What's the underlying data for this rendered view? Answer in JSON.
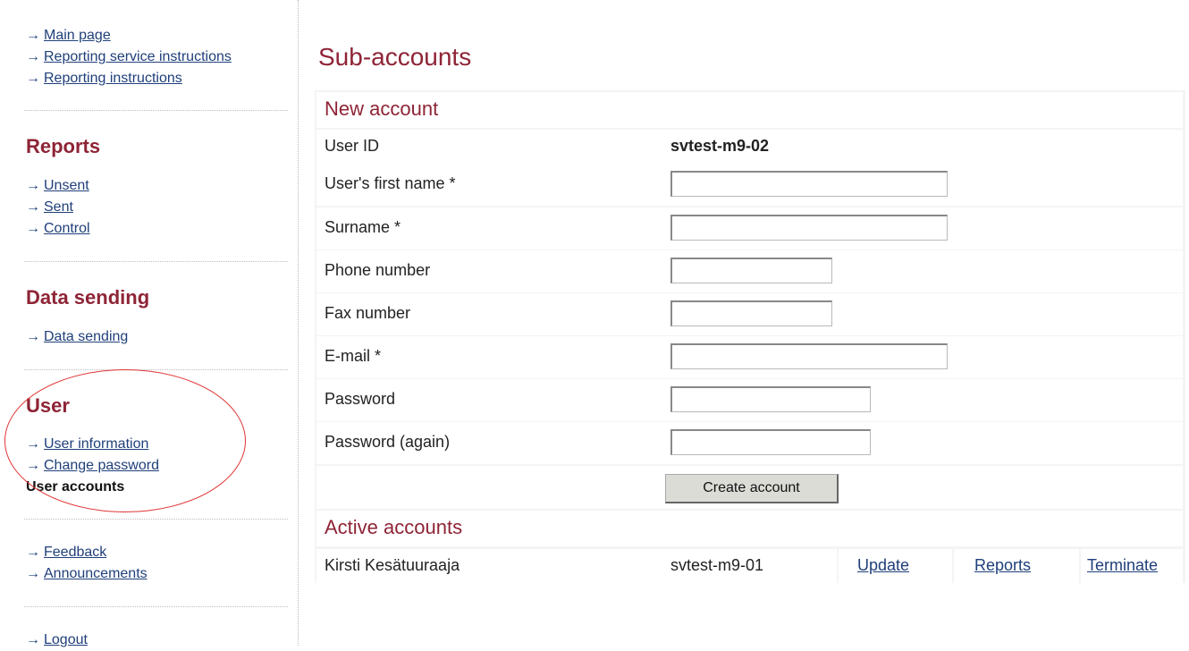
{
  "sidebar": {
    "top_links": [
      "Main page",
      "Reporting service instructions",
      "Reporting instructions"
    ],
    "reports": {
      "heading": "Reports",
      "links": [
        "Unsent",
        "Sent",
        "Control"
      ]
    },
    "data_sending": {
      "heading": "Data sending",
      "links": [
        "Data sending"
      ]
    },
    "user": {
      "heading": "User",
      "links": [
        "User information",
        "Change password"
      ],
      "current": "User accounts"
    },
    "misc_links": [
      "Feedback",
      "Announcements"
    ],
    "logout": "Logout",
    "arrow_glyph": "→",
    "highlight_color": "#e03535"
  },
  "main": {
    "page_title": "Sub-accounts",
    "new_account": {
      "title": "New account",
      "user_id_label": "User ID",
      "user_id_value": "svtest-m9-02",
      "fields": {
        "first_name": {
          "label": "User's first name *",
          "value": ""
        },
        "surname": {
          "label": "Surname *",
          "value": ""
        },
        "phone": {
          "label": "Phone number",
          "value": ""
        },
        "fax": {
          "label": "Fax number",
          "value": ""
        },
        "email": {
          "label": "E-mail *",
          "value": ""
        },
        "password": {
          "label": "Password",
          "value": ""
        },
        "password_again": {
          "label": "Password (again)",
          "value": ""
        }
      },
      "create_button": "Create account"
    },
    "active_accounts": {
      "title": "Active accounts",
      "rows": [
        {
          "name": "Kirsti Kesätuuraaja",
          "user_id": "svtest-m9-01",
          "update": "Update",
          "reports": "Reports",
          "terminate": "Terminate"
        }
      ]
    }
  },
  "colors": {
    "heading": "#8e2436",
    "link": "#1f3f7a",
    "panel_bg": "#f4f4f4"
  }
}
